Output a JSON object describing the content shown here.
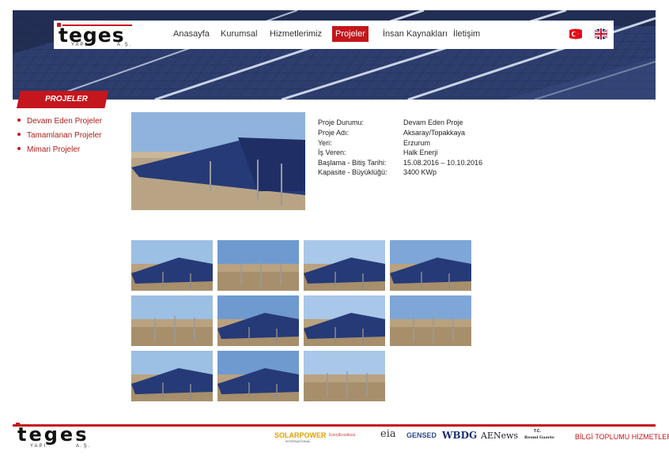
{
  "brand": {
    "name": "teges",
    "subtitle_left": "YAPI",
    "subtitle_right": "A.Ş."
  },
  "nav": {
    "items": [
      {
        "label": "Anasayfa",
        "active": false
      },
      {
        "label": "Kurumsal",
        "active": false
      },
      {
        "label": "Hizmetlerimiz",
        "active": false
      },
      {
        "label": "Projeler",
        "active": true
      },
      {
        "label": "İnsan Kaynakları",
        "active": false
      },
      {
        "label": "İletişim",
        "active": false
      }
    ],
    "languages": [
      "tr-flag-icon",
      "uk-flag-icon"
    ]
  },
  "sidebar": {
    "title": "PROJELER",
    "items": [
      "Devam Eden Projeler",
      "Tamamlanan Projeler",
      "Mimari Projeler"
    ]
  },
  "project": {
    "fields": [
      {
        "label": "Proje Durumu:",
        "value": "Devam Eden Proje"
      },
      {
        "label": "Proje Adı:",
        "value": "Aksaray/Topakkaya"
      },
      {
        "label": "Yeri:",
        "value": "Erzurum"
      },
      {
        "label": "İş Veren:",
        "value": "Halk Enerji"
      },
      {
        "label": "Başlama - Bitiş Tarihi:",
        "value": "15.08.2016 – 10.10.2016"
      },
      {
        "label": "Kapasite - Büyüklüğü:",
        "value": "3400 KWp"
      }
    ]
  },
  "footer": {
    "sponsors": [
      "SOLARPOWER",
      "EnerjiEnstitüsü",
      "eia",
      "GENSED",
      "WBDG",
      "AENews",
      "Resmi Gazete"
    ],
    "sponsor_sub": {
      "solar": "INTERNATIONAL",
      "gazete_top": "T.C."
    },
    "info_link": "BİLGİ TOPLUMU HİZMETLERİ"
  },
  "colors": {
    "accent": "#c4161c",
    "link": "#b01c1c"
  }
}
